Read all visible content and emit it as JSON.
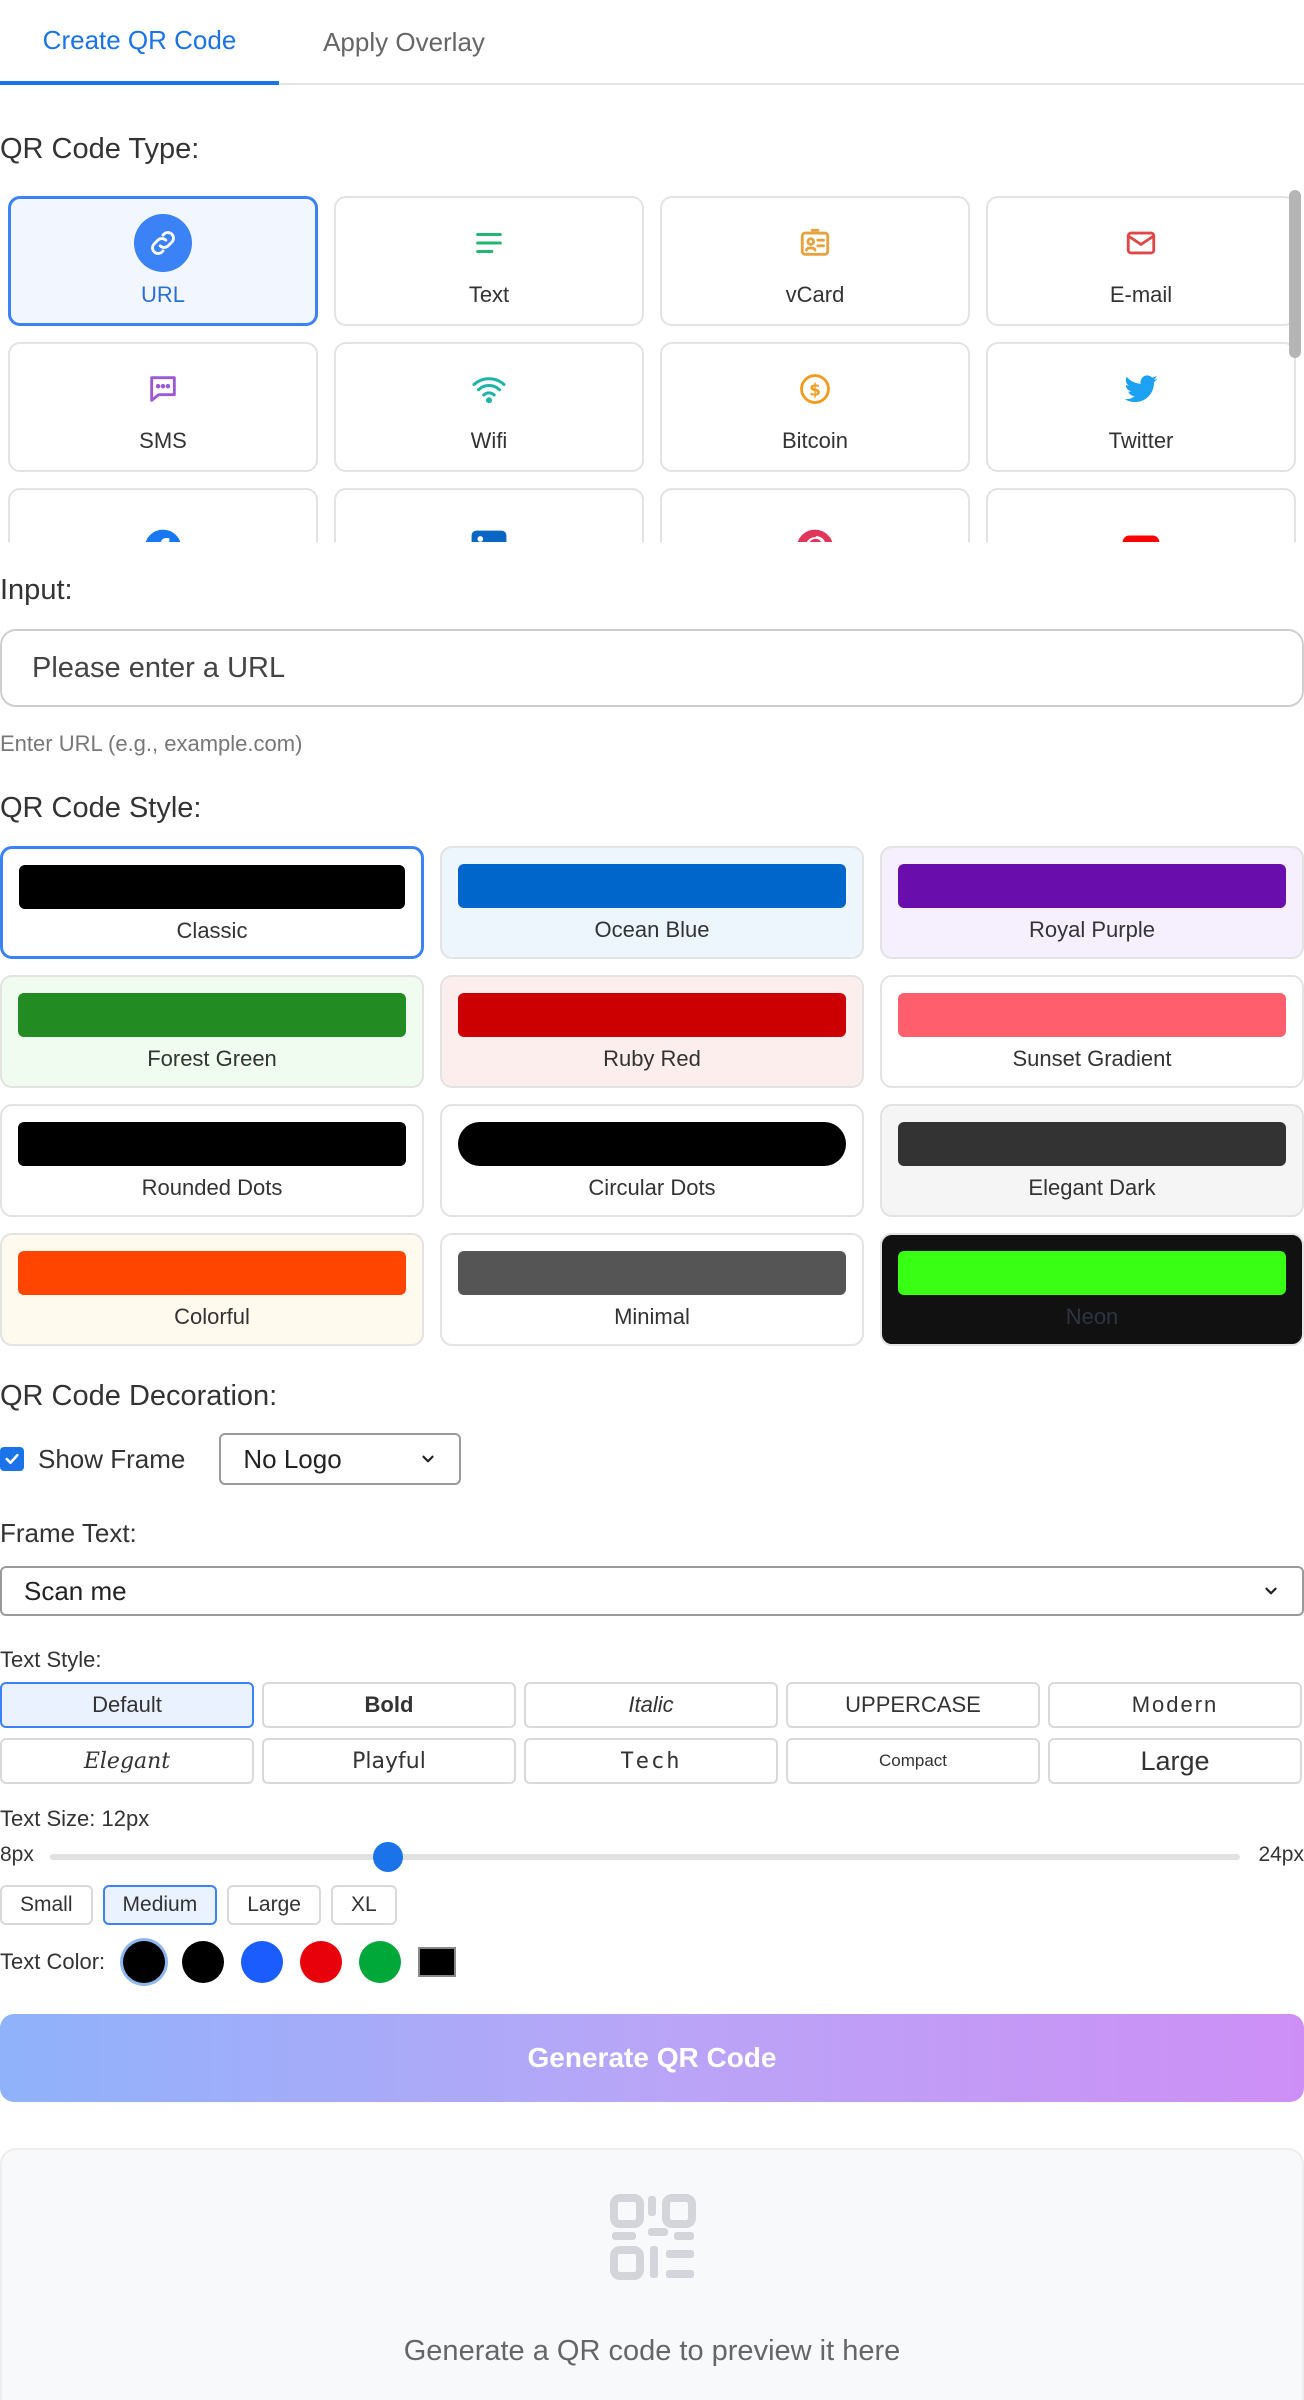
{
  "tabs": [
    {
      "label": "Create QR Code",
      "active": true
    },
    {
      "label": "Apply Overlay",
      "active": false
    }
  ],
  "qr_type": {
    "label": "QR Code Type:",
    "items": [
      {
        "label": "URL",
        "icon": "link-icon",
        "color": "#3b82f6"
      },
      {
        "label": "Text",
        "icon": "text-lines-icon",
        "color": "#22b573"
      },
      {
        "label": "vCard",
        "icon": "contact-card-icon",
        "color": "#e6a23c"
      },
      {
        "label": "E-mail",
        "icon": "envelope-icon",
        "color": "#e04848"
      },
      {
        "label": "SMS",
        "icon": "chat-bubble-icon",
        "color": "#9b59d6"
      },
      {
        "label": "Wifi",
        "icon": "wifi-icon",
        "color": "#1cb5a8"
      },
      {
        "label": "Bitcoin",
        "icon": "bitcoin-icon",
        "color": "#f29b1d"
      },
      {
        "label": "Twitter",
        "icon": "twitter-icon",
        "color": "#1da1f2"
      },
      {
        "label": "",
        "icon": "facebook-icon",
        "color": "#1877f2"
      },
      {
        "label": "",
        "icon": "linkedin-icon",
        "color": "#0a66c2"
      },
      {
        "label": "",
        "icon": "pinterest-icon",
        "color": "#e60023"
      },
      {
        "label": "",
        "icon": "youtube-icon",
        "color": "#ff0000"
      }
    ]
  },
  "input": {
    "label": "Input:",
    "placeholder": "Please enter a URL",
    "hint": "Enter URL (e.g., example.com)"
  },
  "qr_style": {
    "label": "QR Code Style:",
    "items": [
      {
        "label": "Classic",
        "swatch": "#000000",
        "bg": "#ffffff"
      },
      {
        "label": "Ocean Blue",
        "swatch": "#0066cc",
        "bg": "#eef6fd"
      },
      {
        "label": "Royal Purple",
        "swatch": "#6a0dad",
        "bg": "#f6effd"
      },
      {
        "label": "Forest Green",
        "swatch": "#228b22",
        "bg": "#f0fcf0"
      },
      {
        "label": "Ruby Red",
        "swatch": "#cc0000",
        "bg": "#fdeeee"
      },
      {
        "label": "Sunset Gradient",
        "swatch": "#ff5f6d",
        "bg": "#ffffff"
      },
      {
        "label": "Rounded Dots",
        "swatch": "#000000",
        "bg": "#ffffff"
      },
      {
        "label": "Circular Dots",
        "swatch": "#000000",
        "bg": "#ffffff"
      },
      {
        "label": "Elegant Dark",
        "swatch": "#333333",
        "bg": "#f5f5f5"
      },
      {
        "label": "Colorful",
        "swatch": "#ff4500",
        "bg": "#fff9ee"
      },
      {
        "label": "Minimal",
        "swatch": "#555555",
        "bg": "#ffffff"
      },
      {
        "label": "Neon",
        "swatch": "#39ff14",
        "bg": "#111111"
      }
    ]
  },
  "decoration": {
    "label": "QR Code Decoration:",
    "show_frame_label": "Show Frame",
    "logo_selected": "No Logo",
    "frame_text_label": "Frame Text:",
    "frame_text_selected": "Scan me"
  },
  "text_style": {
    "label": "Text Style:",
    "items": [
      "Default",
      "Bold",
      "Italic",
      "UPPERCASE",
      "Modern",
      "Elegant",
      "Playful",
      "Tech",
      "Compact",
      "Large"
    ]
  },
  "text_size": {
    "label": "Text Size: 12px",
    "min_label": "8px",
    "max_label": "24px",
    "min": 8,
    "max": 24,
    "value": 12,
    "presets": [
      "Small",
      "Medium",
      "Large",
      "XL"
    ]
  },
  "text_color": {
    "label": "Text Color:",
    "swatches": [
      "#000000",
      "#000000",
      "#1a5cff",
      "#e8000b",
      "#00a83a"
    ],
    "custom": "#000000"
  },
  "generate_label": "Generate QR Code",
  "preview_text": "Generate a QR code to preview it here",
  "accent": "#1a73e8"
}
